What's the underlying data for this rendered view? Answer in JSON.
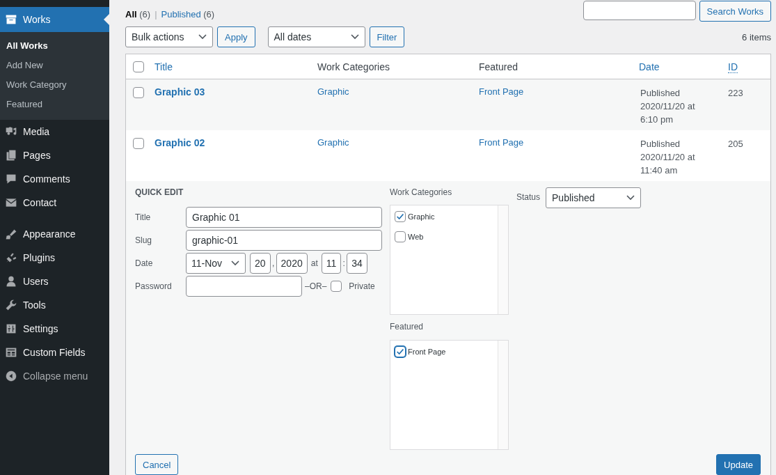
{
  "sidebar": {
    "groups": [
      {
        "items": [
          {
            "label": "Works",
            "selected": true,
            "children": [
              {
                "label": "All Works",
                "selected": true
              },
              {
                "label": "Add New",
                "selected": false
              },
              {
                "label": "Work Category",
                "selected": false
              },
              {
                "label": "Featured",
                "selected": false
              }
            ]
          },
          {
            "label": "Media",
            "selected": false
          },
          {
            "label": "Pages",
            "selected": false
          },
          {
            "label": "Comments",
            "selected": false
          },
          {
            "label": "Contact",
            "selected": false
          }
        ]
      },
      {
        "items": [
          {
            "label": "Appearance",
            "selected": false
          },
          {
            "label": "Plugins",
            "selected": false
          },
          {
            "label": "Users",
            "selected": false
          },
          {
            "label": "Tools",
            "selected": false
          },
          {
            "label": "Settings",
            "selected": false
          },
          {
            "label": "Custom Fields",
            "selected": false
          }
        ]
      }
    ],
    "collapse_label": "Collapse menu"
  },
  "views": {
    "items": [
      {
        "label": "All",
        "count": "(6)",
        "selected": true
      },
      {
        "label": "Published",
        "count": "(6)",
        "selected": false
      }
    ],
    "separator": "|"
  },
  "search": {
    "button": "Search Works"
  },
  "toolbar": {
    "bulk_actions": "Bulk actions",
    "apply": "Apply",
    "dates": "All dates",
    "filter": "Filter",
    "item_count": "6 items"
  },
  "table": {
    "select_all_checked": false,
    "columns": [
      {
        "label": "Title",
        "sortable": true,
        "abbr": false
      },
      {
        "label": "Work Categories",
        "sortable": false,
        "abbr": false
      },
      {
        "label": "Featured",
        "sortable": false,
        "abbr": false
      },
      {
        "label": "Date",
        "sortable": true,
        "abbr": false
      },
      {
        "label": "ID",
        "sortable": true,
        "abbr": true
      }
    ],
    "rows": [
      {
        "checked": false,
        "title": "Graphic 03",
        "category": "Graphic",
        "featured": "Front Page",
        "status": "Published",
        "date": "2020/11/20 at 6:10 pm",
        "id": "223"
      },
      {
        "checked": false,
        "title": "Graphic 02",
        "category": "Graphic",
        "featured": "Front Page",
        "status": "Published",
        "date": "2020/11/20 at 11:40 am",
        "id": "205"
      }
    ]
  },
  "quick_edit": {
    "heading": "QUICK EDIT",
    "fields": [
      {
        "label": "Title",
        "value": "Graphic 01"
      },
      {
        "label": "Slug",
        "value": "graphic-01"
      }
    ],
    "date": {
      "label": "Date",
      "month": "11-Nov",
      "day": "20",
      "comma": ",",
      "year": "2020",
      "at": "at",
      "hour": "11",
      "colon": ":",
      "minute": "34"
    },
    "password": {
      "label": "Password",
      "or": "–OR–",
      "private_label": "Private",
      "private_checked": false
    },
    "categories": {
      "label": "Work Categories",
      "items": [
        {
          "label": "Graphic",
          "checked": true,
          "focused": false
        },
        {
          "label": "Web",
          "checked": false,
          "focused": false
        }
      ]
    },
    "featured": {
      "label": "Featured",
      "items": [
        {
          "label": "Front Page",
          "checked": true,
          "focused": true
        }
      ]
    },
    "status": {
      "label": "Status",
      "value": "Published"
    },
    "cancel": "Cancel",
    "update": "Update"
  }
}
